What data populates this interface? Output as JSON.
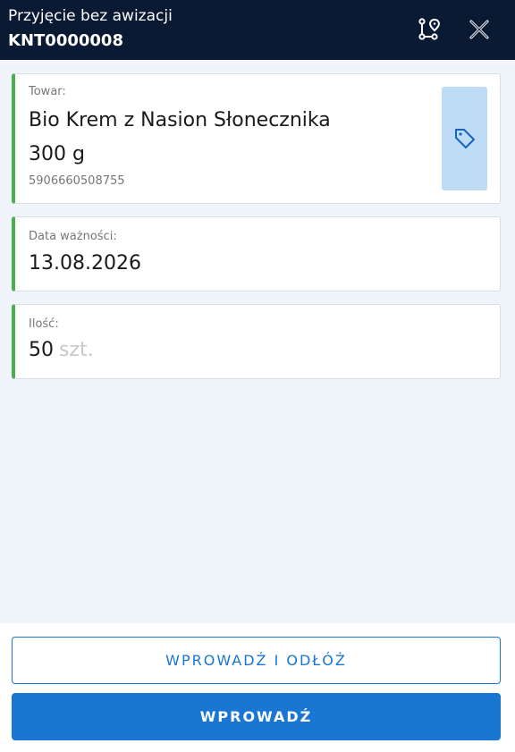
{
  "header": {
    "title": "Przyjęcie bez awizacji",
    "document_number": "KNT0000008",
    "route_icon": "route-icon",
    "close_icon": "close-icon"
  },
  "product": {
    "label": "Towar:",
    "name": "Bio Krem z Nasion Słonecznika",
    "weight": "300 g",
    "ean": "5906660508755",
    "tag_icon": "tag-icon"
  },
  "expiry": {
    "label": "Data ważności:",
    "value": "13.08.2026"
  },
  "quantity": {
    "label": "Ilość:",
    "value": "50",
    "unit": "szt."
  },
  "actions": {
    "enter_and_store": "WPROWADŹ I ODŁÓŻ",
    "enter": "WPROWADŹ"
  },
  "colors": {
    "header_bg": "#0b1a33",
    "accent": "#1976d2",
    "card_marker": "#4caf50",
    "tag_button_bg": "#bfdcf7"
  }
}
